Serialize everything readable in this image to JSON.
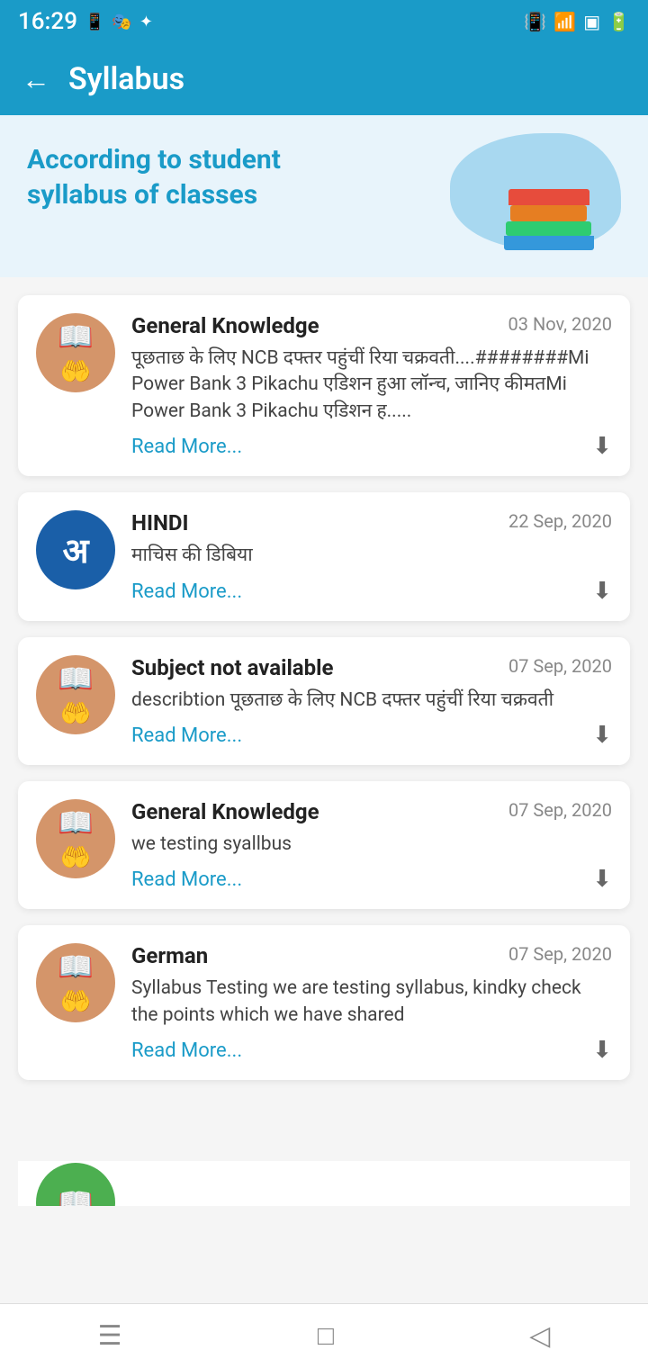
{
  "statusBar": {
    "time": "16:29",
    "leftIcons": [
      "📱",
      "🎭",
      "🔵"
    ],
    "rightIcons": [
      "📳",
      "📶",
      "🔋"
    ]
  },
  "header": {
    "back_label": "←",
    "title": "Syllabus"
  },
  "hero": {
    "line1": "According to student",
    "line2": "syllabus of classes"
  },
  "cards": [
    {
      "id": 1,
      "title": "General Knowledge",
      "date": "03 Nov, 2020",
      "description": "पूछताछ के लिए NCB दफ्तर पहुंचीं रिया चक्रवती....########Mi Power Bank 3 Pikachu एडिशन हुआ लॉन्च, जानिए कीमतMi Power Bank 3 Pikachu एडिशन ह.....",
      "read_more": "Read More...",
      "icon_type": "book",
      "icon_bg": "tan"
    },
    {
      "id": 2,
      "title": "HINDI",
      "date": "22 Sep, 2020",
      "description": "माचिस की डिबिया",
      "read_more": "Read More...",
      "icon_type": "hindi",
      "icon_bg": "blue"
    },
    {
      "id": 3,
      "title": "Subject not available",
      "date": "07 Sep, 2020",
      "description": "describtion पूछताछ के लिए NCB दफ्तर पहुंचीं रिया चक्रवती",
      "read_more": "Read More...",
      "icon_type": "book",
      "icon_bg": "tan"
    },
    {
      "id": 4,
      "title": "General Knowledge",
      "date": "07 Sep, 2020",
      "description": "we testing syallbus",
      "read_more": "Read More...",
      "icon_type": "book",
      "icon_bg": "tan"
    },
    {
      "id": 5,
      "title": "German",
      "date": "07 Sep, 2020",
      "description": "Syllabus Testing we are testing syllabus, kindky check the points which we have shared",
      "read_more": "Read More...",
      "icon_type": "book",
      "icon_bg": "tan"
    }
  ],
  "bottomNav": {
    "menu_icon": "☰",
    "home_icon": "□",
    "back_icon": "◁"
  }
}
